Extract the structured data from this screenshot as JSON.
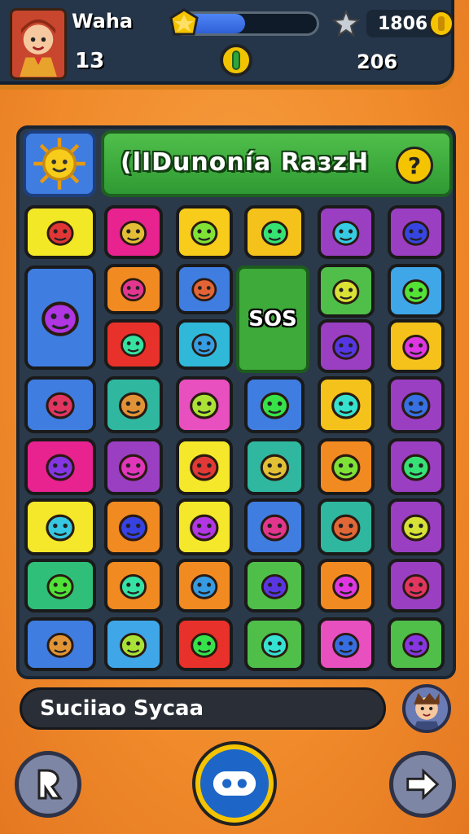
{
  "player": {
    "name": "Waha",
    "level": "13"
  },
  "hud": {
    "score": "1806",
    "secondary_score": "206",
    "xp_progress": 0.5
  },
  "board": {
    "title": "(lIDunonía RaзzH",
    "center_label": "SOS"
  },
  "status": {
    "text": "Suciiao Sycaa"
  },
  "colors": {
    "background": "#f08a2a",
    "topbar": "#25354a",
    "banner": "#3daa3a",
    "coin": "#f5c400"
  },
  "tiles": [
    {
      "icon": "meat-icon",
      "color": "#f2e826"
    },
    {
      "icon": "crossed-box-icon",
      "color": "#e8228f"
    },
    {
      "icon": "sun-icon",
      "color": "#f7cc1a"
    },
    {
      "icon": "pencil-icon",
      "color": "#f5c21b"
    },
    {
      "icon": "dino-icon",
      "color": "#9a3fc2"
    },
    {
      "icon": "bird-icon",
      "color": "#9a3fc2"
    },
    {
      "icon": "compass-icon",
      "color": "#3f7de0"
    },
    {
      "icon": "cat-icon",
      "color": "#f28a22"
    },
    {
      "icon": "gear-monster-icon",
      "color": "#3f7de0"
    },
    {
      "icon": "face-blue-hat-icon",
      "color": "#4fbf4a"
    },
    {
      "icon": "lollipop-icon",
      "color": "#3fa6e8"
    },
    {
      "icon": "bird-yellow-icon",
      "color": "#e8312a"
    },
    {
      "icon": "bug-icon",
      "color": "#2fb8d8"
    },
    {
      "icon": "bottle-icon",
      "color": "#9a3fc2"
    },
    {
      "icon": "spiral-icon",
      "color": "#f5c21b"
    },
    {
      "icon": "joystick-icon",
      "color": "#3f7de0"
    },
    {
      "icon": "cookie-icon",
      "color": "#2fb7a0"
    },
    {
      "icon": "heart-icon",
      "color": "#e84fbf"
    },
    {
      "icon": "marker-icon",
      "color": "#3f7de0"
    },
    {
      "icon": "frog-icon",
      "color": "#f5c21b"
    },
    {
      "icon": "gun-icon",
      "color": "#9a3fc2"
    },
    {
      "icon": "bag-icon",
      "color": "#e8228f"
    },
    {
      "icon": "hat-icon",
      "color": "#9a3fc2"
    },
    {
      "icon": "wrench-icon",
      "color": "#f5e82a"
    },
    {
      "icon": "calculator-icon",
      "color": "#2fb7a0"
    },
    {
      "icon": "kid-face-icon",
      "color": "#f28a22"
    },
    {
      "icon": "question-icon",
      "color": "#9a3fc2"
    },
    {
      "icon": "sausage-icon",
      "color": "#f5e82a"
    },
    {
      "icon": "monster-icon",
      "color": "#f28a22"
    },
    {
      "icon": "hammer-icon",
      "color": "#f5e82a"
    },
    {
      "icon": "fish-icon",
      "color": "#3f7de0"
    },
    {
      "icon": "leaf-icon",
      "color": "#2fb7a0"
    },
    {
      "icon": "flower-icon",
      "color": "#9a3fc2"
    },
    {
      "icon": "worm-icon",
      "color": "#2fbf78"
    },
    {
      "icon": "frog-star-icon",
      "color": "#f28a22"
    },
    {
      "icon": "tomato-icon",
      "color": "#f28a22"
    },
    {
      "icon": "marker-red-icon",
      "color": "#4fbf4a"
    },
    {
      "icon": "ghost-icon",
      "color": "#f28a22"
    },
    {
      "icon": "ball-icon",
      "color": "#9a3fc2"
    },
    {
      "icon": "sun-orange-icon",
      "color": "#3f7de0"
    },
    {
      "icon": "elf-face-icon",
      "color": "#3fa6e8"
    },
    {
      "icon": "bowl-icon",
      "color": "#e8312a"
    },
    {
      "icon": "popsicle-icon",
      "color": "#4fbf4a"
    },
    {
      "icon": "pen-icon",
      "color": "#e84fbf"
    },
    {
      "icon": "pencil-green-icon",
      "color": "#4fbf4a"
    }
  ]
}
